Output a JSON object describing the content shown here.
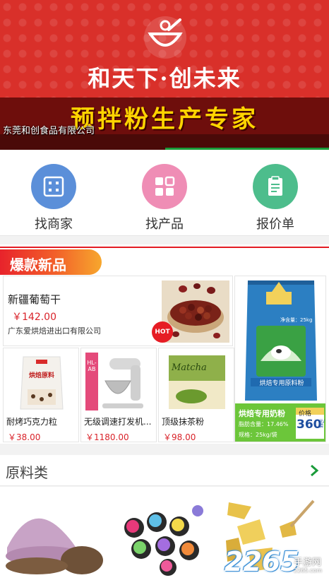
{
  "banner": {
    "slogan": "和天下·创未来",
    "title": "预拌粉生产专家",
    "caption": "东莞和创食品有限公司"
  },
  "quicknav": [
    {
      "label": "找商家",
      "icon": "store-grid-icon",
      "color": "#5b8fd9"
    },
    {
      "label": "找产品",
      "icon": "product-tiles-icon",
      "color": "#ef8db5"
    },
    {
      "label": "报价单",
      "icon": "quote-sheet-icon",
      "color": "#4dbd8c"
    }
  ],
  "hot_section": {
    "title": "爆款新品",
    "main_product": {
      "name": "新疆葡萄干",
      "price": "￥142.00",
      "seller": "广东爱烘焙进出口有限公司",
      "badge": "HOT"
    },
    "side_product": {
      "bag_text": "烘焙专用原料粉",
      "name": "烘焙专用奶粉",
      "spec1": "脂肪含量：17.46%",
      "spec2": "规格：25kg/袋",
      "price_label": "价格",
      "price": "360",
      "price_unit": "元/袋",
      "bag_net": "净含量：25kg"
    },
    "small_products": [
      {
        "name": "耐烤巧克力粒",
        "price": "￥38.00",
        "pack_text": "烘焙原料"
      },
      {
        "name": "无级调速打发机...",
        "price": "￥1180.00",
        "pack_text": "HL-AB"
      },
      {
        "name": "顶级抹茶粉",
        "price": "￥98.00",
        "pack_text": "Matcha"
      }
    ]
  },
  "raw_section": {
    "title": "原料类"
  },
  "watermark": {
    "number": "2265",
    "suffix": "手游网",
    "url": "2265.com"
  },
  "colors": {
    "banner_red": "#d9302a",
    "accent_red": "#e31b23",
    "price_red": "#d9232a",
    "progress_green": "#1a9b3a"
  }
}
